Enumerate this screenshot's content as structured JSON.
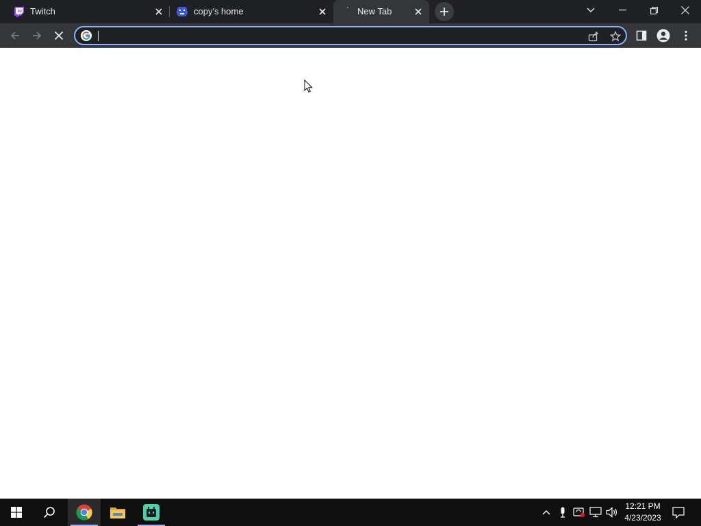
{
  "browser": {
    "tabs": [
      {
        "title": "Twitch",
        "favicon": "twitch-icon",
        "active": false
      },
      {
        "title": "copy's home",
        "favicon": "game-icon",
        "active": false
      },
      {
        "title": "New Tab",
        "favicon": "loading-icon",
        "active": true
      }
    ],
    "omnibox": {
      "value": "",
      "placeholder": ""
    }
  },
  "taskbar": {
    "apps": [
      {
        "name": "chrome-icon",
        "active": true
      },
      {
        "name": "file-explorer-icon",
        "active": false
      },
      {
        "name": "app-icon",
        "active": false
      }
    ],
    "clock": {
      "time": "12:21 PM",
      "date": "4/23/2023"
    }
  },
  "colors": {
    "tab_strip_bg": "#202124",
    "toolbar_bg": "#35363a",
    "omnibox_focus": "#8ab4f8",
    "twitch": "#9146ff",
    "taskbar_bg": "#0f0f10"
  }
}
